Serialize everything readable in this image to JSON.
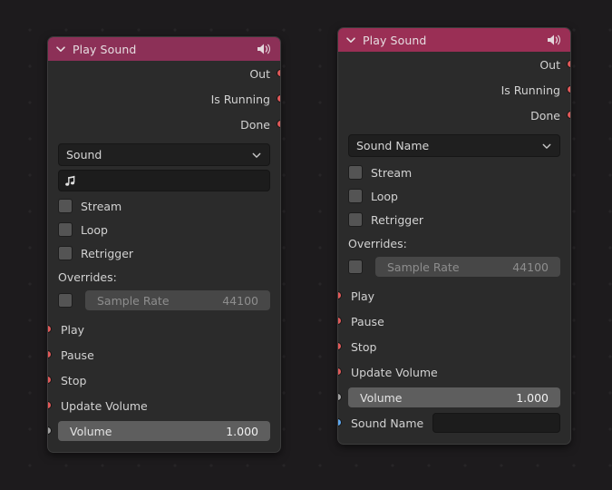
{
  "canvas": {
    "background_color": "#1d1b1d",
    "grid_dot_color": "#272527"
  },
  "nodes": [
    {
      "id": "play-sound-left",
      "title": "Play Sound",
      "header_color": "#8c3057",
      "header_icon": "speaker-icon",
      "collapse_icon": "chevron-down-icon",
      "outputs": [
        {
          "label": "Out",
          "socket_color": "#e05a5a"
        },
        {
          "label": "Is Running",
          "socket_color": "#e05a5a"
        },
        {
          "label": "Done",
          "socket_color": "#e05a5a"
        }
      ],
      "mode_dropdown": {
        "value": "Sound",
        "chevron": "chevron-down-icon"
      },
      "sound_field": {
        "icon": "music-note-icon",
        "value": ""
      },
      "checkboxes": [
        {
          "label": "Stream",
          "checked": false
        },
        {
          "label": "Loop",
          "checked": false
        },
        {
          "label": "Retrigger",
          "checked": false
        }
      ],
      "overrides_label": "Overrides:",
      "overrides": [
        {
          "checked": false,
          "name": "Sample Rate",
          "value": "44100",
          "enabled": false
        }
      ],
      "inputs": [
        {
          "label": "Play",
          "socket_color": "#e05a5a"
        },
        {
          "label": "Pause",
          "socket_color": "#e05a5a"
        },
        {
          "label": "Stop",
          "socket_color": "#e05a5a"
        },
        {
          "label": "Update Volume",
          "socket_color": "#e05a5a"
        }
      ],
      "volume": {
        "name": "Volume",
        "value": "1.000",
        "socket_color": "#a1a1a1"
      }
    },
    {
      "id": "play-sound-right",
      "title": "Play Sound",
      "header_color": "#9a2f55",
      "header_icon": "speaker-icon",
      "collapse_icon": "chevron-down-icon",
      "outputs": [
        {
          "label": "Out",
          "socket_color": "#e05a5a"
        },
        {
          "label": "Is Running",
          "socket_color": "#e05a5a"
        },
        {
          "label": "Done",
          "socket_color": "#e05a5a"
        }
      ],
      "mode_dropdown": {
        "value": "Sound Name",
        "chevron": "chevron-down-icon"
      },
      "checkboxes": [
        {
          "label": "Stream",
          "checked": false
        },
        {
          "label": "Loop",
          "checked": false
        },
        {
          "label": "Retrigger",
          "checked": false
        }
      ],
      "overrides_label": "Overrides:",
      "overrides": [
        {
          "checked": false,
          "name": "Sample Rate",
          "value": "44100",
          "enabled": false
        }
      ],
      "inputs": [
        {
          "label": "Play",
          "socket_color": "#e05a5a"
        },
        {
          "label": "Pause",
          "socket_color": "#e05a5a"
        },
        {
          "label": "Stop",
          "socket_color": "#e05a5a"
        },
        {
          "label": "Update Volume",
          "socket_color": "#e05a5a"
        }
      ],
      "volume": {
        "name": "Volume",
        "value": "1.000",
        "socket_color": "#a1a1a1"
      },
      "sound_name": {
        "label": "Sound Name",
        "value": "",
        "socket_color": "#5ea8ef"
      }
    }
  ]
}
